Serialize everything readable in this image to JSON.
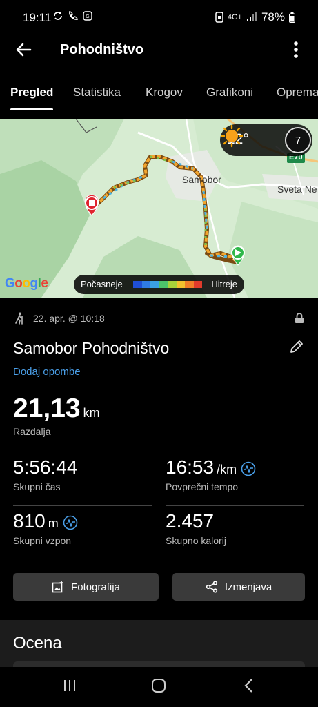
{
  "status_bar": {
    "time": "19:11",
    "network": "4G+",
    "battery": "78%"
  },
  "app_bar": {
    "title": "Pohodništvo"
  },
  "tabs": [
    {
      "label": "Pregled",
      "active": true
    },
    {
      "label": "Statistika",
      "active": false
    },
    {
      "label": "Krogov",
      "active": false
    },
    {
      "label": "Grafikoni",
      "active": false
    },
    {
      "label": "Oprema",
      "active": false
    }
  ],
  "map": {
    "temperature": "12°",
    "weather_icon": "sun-icon",
    "wind_speed": "7",
    "labels": {
      "samobor": "Samobor",
      "sveta_nedelja": "Sveta Ne",
      "road": "E70"
    },
    "provider": "Google",
    "legend": {
      "slow": "Počasneje",
      "fast": "Hitreje",
      "colors": [
        "#1f4fd6",
        "#2f7be6",
        "#3aa1e6",
        "#4cc36a",
        "#a6d23a",
        "#f2c12e",
        "#f07e28",
        "#e03b2c"
      ]
    },
    "route_colors": {
      "start": "#2fb84a",
      "finish": "#e0242f"
    }
  },
  "activity": {
    "date": "22. apr. @ 10:18",
    "title": "Samobor Pohodništvo",
    "add_notes": "Dodaj opombe",
    "distance": {
      "value": "21,13",
      "unit": "km",
      "label": "Razdalja"
    },
    "stats": [
      {
        "value": "5:56:44",
        "unit": "",
        "label": "Skupni čas",
        "has_wave": false
      },
      {
        "value": "16:53",
        "unit": "/km",
        "label": "Povprečni tempo",
        "has_wave": true
      },
      {
        "value": "810",
        "unit": "m",
        "label": "Skupni vzpon",
        "has_wave": true
      },
      {
        "value": "2.457",
        "unit": "",
        "label": "Skupno kalorij",
        "has_wave": false
      }
    ]
  },
  "buttons": {
    "photo": "Fotografija",
    "share": "Izmenjava"
  },
  "section": {
    "title": "Ocena"
  }
}
